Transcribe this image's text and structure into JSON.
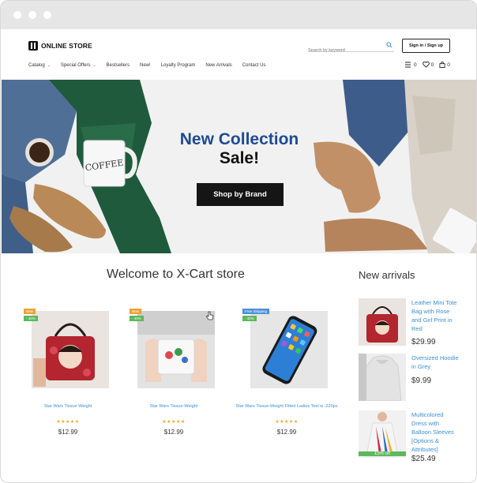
{
  "window": {
    "dots": [
      "dot",
      "dot",
      "dot"
    ]
  },
  "header": {
    "logo_text": "ONLINE STORE",
    "search": {
      "placeholder": "Search by keyword",
      "value": ""
    },
    "signin_label": "Sign in / Sign up"
  },
  "nav": {
    "items": [
      {
        "label": "Catalog",
        "has_caret": true
      },
      {
        "label": "Special Offers",
        "has_caret": true
      },
      {
        "label": "Bestsellers",
        "has_caret": false
      },
      {
        "label": "New!",
        "has_caret": false
      },
      {
        "label": "Loyalty Program",
        "has_caret": false
      },
      {
        "label": "New Arrivals",
        "has_caret": false
      },
      {
        "label": "Contact Us",
        "has_caret": false
      }
    ],
    "compare_count": "0",
    "wishlist_count": "0",
    "cart_count": "0"
  },
  "hero": {
    "title": "New Collection",
    "subtitle": "Sale!",
    "button_label": "Shop by Brand",
    "title_color": "#1e4a93",
    "mug_text": "COFFEE"
  },
  "welcome": {
    "title": "Welcome to X-Cart store"
  },
  "products": [
    {
      "name": "Star Wars Tissue-Weight",
      "badge_top": "New",
      "badge_bottom": "- 40%",
      "stars": "★★★★★",
      "price": "$12.99",
      "image": "red-bag"
    },
    {
      "name": "Star Wars Tissue-Weight",
      "badge_top": "New",
      "badge_bottom": "- 40%",
      "stars": "★★★★★",
      "price": "$12.99",
      "image": "mug"
    },
    {
      "name": "Star Wars Tissue-Weight Fitted Ladies Teel w -220px",
      "badge_top": "Free Shipping",
      "badge_bottom": "- 40%",
      "stars": "★★★★★",
      "price": "$12.99",
      "image": "phone"
    }
  ],
  "arrivals": {
    "title": "New arrivals",
    "items": [
      {
        "name": "Leather Mini Tote Bag with Rose and Girl Print in Red",
        "price": "$29.99",
        "badge": ""
      },
      {
        "name": "Oversized Hoodie in Grey",
        "price": "$9.99",
        "badge": ""
      },
      {
        "name": "Multicolored Dress with Balloon Sleeves [Options & Attributes]",
        "price": "$25.49",
        "badge": "15% off"
      }
    ]
  },
  "colors": {
    "link": "#3b8fd1",
    "new_badge": "#f0a035",
    "discount_badge": "#5cb85c",
    "shipping_badge": "#4a90d9",
    "stars": "#f5a623"
  }
}
